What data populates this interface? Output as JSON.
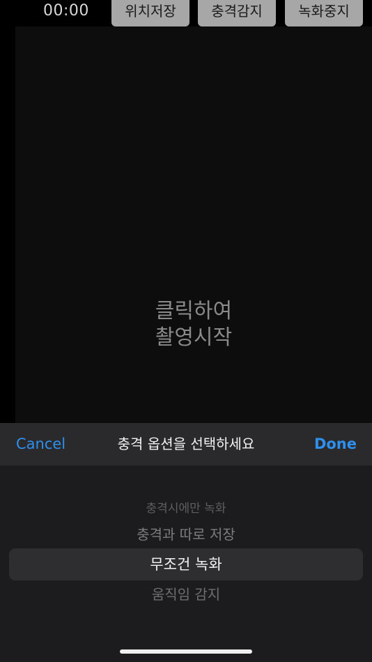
{
  "top_bar": {
    "timer": "00:00",
    "buttons": {
      "save_location": "위치저장",
      "shock_detect": "충격감지",
      "stop_recording": "녹화중지"
    }
  },
  "preview": {
    "prompt_line1": "클릭하여",
    "prompt_line2": "촬영시작"
  },
  "picker": {
    "cancel_label": "Cancel",
    "title": "충격 옵션을 선택하세요",
    "done_label": "Done",
    "options": [
      "충격시에만 녹화",
      "충격과 따로 저장",
      "무조건 녹화",
      "움직임 감지"
    ],
    "selected": "무조건 녹화"
  },
  "colors": {
    "accent": "#2f8fec",
    "toolbar_bg": "#2a2a2c",
    "picker_bg": "#1c1c1e",
    "top_button_bg": "#a7a7a7"
  }
}
